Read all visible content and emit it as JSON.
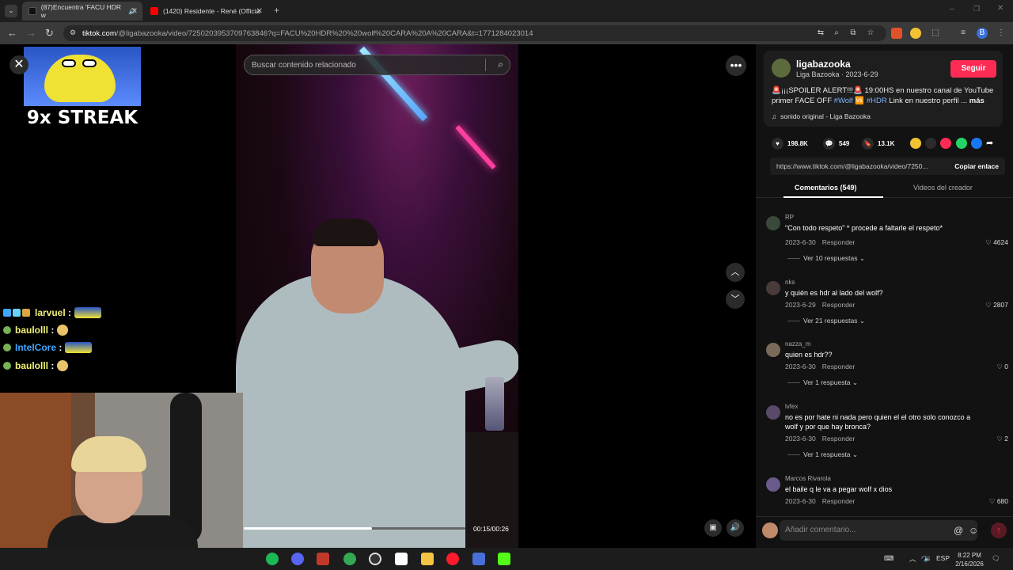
{
  "browser": {
    "tabs": [
      {
        "label": "(87)Encuentra 'FACU HDR w"
      },
      {
        "label": "(1420) Residente - René (Officia"
      }
    ],
    "url_host": "tiktok.com",
    "url_path": "/@ligabazooka/video/7250203953709763846?q=FACU%20HDR%20%20wolf%20CARA%20A%20CARA&t=1771284023014"
  },
  "overlay": {
    "streak": "9x STREAK",
    "chat": [
      {
        "user": "larvuel",
        "sep": ":",
        "color": "#f2f27a"
      },
      {
        "user": "baulolll",
        "sep": ":",
        "color": "#f2f27a"
      },
      {
        "user": "IntelCore",
        "sep": ":",
        "color": "#3fa7ff"
      },
      {
        "user": "baulolll",
        "sep": ":",
        "color": "#f2f27a"
      }
    ]
  },
  "video": {
    "search_placeholder": "Buscar contenido relacionado",
    "progress": 0.58,
    "time": "00:15/00:26"
  },
  "creator": {
    "username": "ligabazooka",
    "subline": "Liga Bazooka · 2023-6-29",
    "follow_label": "Seguir",
    "desc_start": "🚨¡¡¡SPOILER ALERT!!!🚨 19:00HS en nuestro canal de YouTube primer FACE OFF ",
    "tag1": "#Wolf",
    "desc_mid": " 🆚 ",
    "tag2": "#HDR",
    "desc_end": " Link en nuestro perfil ... ",
    "more": "más",
    "music": "sonido original - Liga Bazooka"
  },
  "stats": {
    "likes": "198.8K",
    "comments": "549",
    "saves": "13.1K"
  },
  "link": {
    "url": "https://www.tiktok.com/@ligabazooka/video/7250...",
    "copy_label": "Copiar enlace"
  },
  "panel_tabs": {
    "comments": "Comentarios (549)",
    "creator_videos": "Videos del creador"
  },
  "comments": [
    {
      "user": "RP",
      "text": "\"Con todo respeto\" * procede a faltarle el respeto*",
      "date": "2023-6-30",
      "reply": "Responder",
      "likes": "4624",
      "replies": "Ver 10 respuestas"
    },
    {
      "user": "nks",
      "text": "y quién es hdr al lado del wolf?",
      "date": "2023-6-29",
      "reply": "Responder",
      "likes": "2807",
      "replies": "Ver 21 respuestas"
    },
    {
      "user": "nazza_m",
      "text": "quien es hdr??",
      "date": "2023-6-30",
      "reply": "Responder",
      "likes": "0",
      "replies": "Ver 1 respuesta"
    },
    {
      "user": "lvfex",
      "text": "no es por hate ni nada pero quien el el otro solo conozco a wolf y por que hay bronca?",
      "date": "2023-6-30",
      "reply": "Responder",
      "likes": "2",
      "replies": "Ver 1 respuesta"
    },
    {
      "user": "Marcos Rivarola",
      "text": "el baile q le va a pegar wolf x dios",
      "date": "2023-6-30",
      "reply": "Responder",
      "likes": "680",
      "replies": ""
    }
  ],
  "comment_input_placeholder": "Añadir comentario...",
  "taskbar": {
    "lang": "ESP",
    "time": "8:22 PM",
    "date": "2/16/2026"
  },
  "colors": {
    "accent": "#fe2c55",
    "hashtag": "#7fb4ff"
  }
}
